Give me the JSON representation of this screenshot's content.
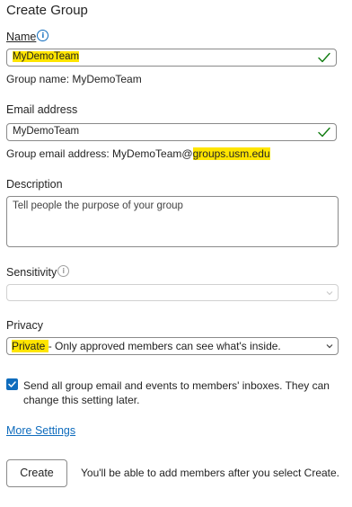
{
  "form": {
    "title": "Create Group",
    "name": {
      "label": "Name",
      "value": "MyDemoTeam",
      "helper": "Group name: MyDemoTeam"
    },
    "email": {
      "label": "Email address",
      "value": "MyDemoTeam",
      "helper_prefix": "Group email address: MyDemoTeam@",
      "helper_domain": "groups.usm.edu"
    },
    "description": {
      "label": "Description",
      "placeholder": "Tell people the purpose of your group"
    },
    "sensitivity": {
      "label": "Sensitivity",
      "value": ""
    },
    "privacy": {
      "label": "Privacy",
      "value_highlight": "Private ",
      "value_rest": "- Only approved members can see what's inside."
    },
    "send_email": {
      "checked": true,
      "label": "Send all group email and events to members' inboxes. They can change this setting later."
    },
    "more_settings": "More Settings",
    "create_button": "Create",
    "create_note": "You'll be able to add members after you select Create."
  },
  "colors": {
    "accent": "#0f6cbd",
    "highlight": "#ffe500",
    "valid_check": "#107c10"
  },
  "icons": {
    "info": "info-icon",
    "valid": "checkmark-icon",
    "dropdown": "chevron-down-icon"
  }
}
